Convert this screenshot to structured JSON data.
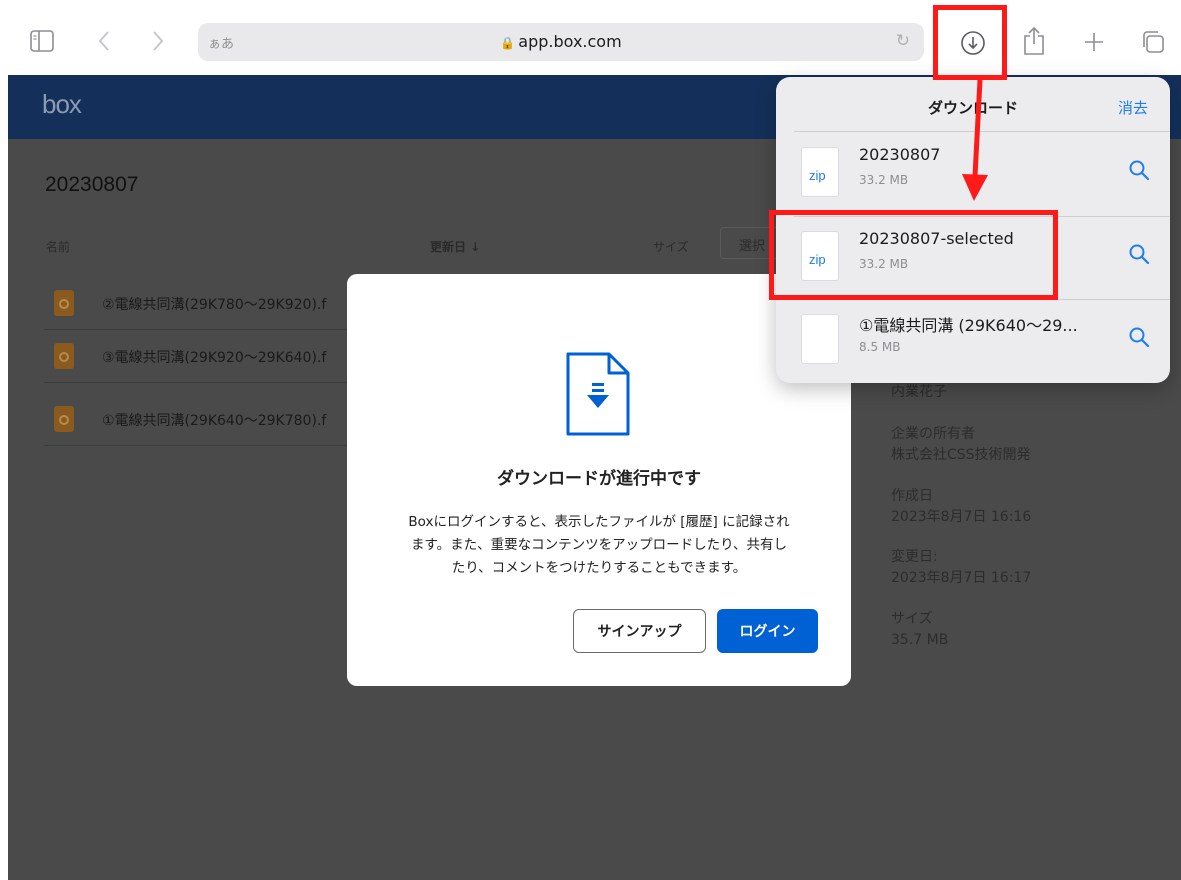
{
  "browser": {
    "address_aa": "ぁあ",
    "url": "app.box.com"
  },
  "icons": {
    "sidebar": "sidebar-icon",
    "back": "back-chevron-icon",
    "forward": "forward-chevron-icon",
    "lock": "lock-icon",
    "reload": "reload-icon",
    "downloads": "download-circle-icon",
    "share": "share-icon",
    "new_tab": "plus-icon",
    "tabs": "tabs-icon"
  },
  "box": {
    "logo": "box",
    "folder_title": "20230807",
    "columns": {
      "name": "名前",
      "modified": "更新日 ↓",
      "size": "サイズ",
      "select": "選択"
    },
    "files": [
      {
        "name": "②電線共同溝(29K780～29K920).f"
      },
      {
        "name": "③電線共同溝(29K920～29K640).f"
      },
      {
        "name": "①電線共同溝(29K640～29K780).f"
      }
    ],
    "details": {
      "owner_name": "内業花子",
      "enterprise_owner_label": "企業の所有者",
      "enterprise_owner": "株式会社CSS技術開発",
      "created_label": "作成日",
      "created": "2023年8月7日 16:16",
      "modified_label": "変更日:",
      "modified": "2023年8月7日 16:17",
      "size_label": "サイズ",
      "size": "35.7 MB"
    }
  },
  "dialog": {
    "title": "ダウンロードが進行中です",
    "body_line1": "Boxにログインすると、表示したファイルが [履歴] に記録され",
    "body_line2": "ます。また、重要なコンテンツをアップロードしたり、共有し",
    "body_line3": "たり、コメントをつけたりすることもできます。",
    "signup": "サインアップ",
    "login": "ログイン"
  },
  "downloads": {
    "title": "ダウンロード",
    "clear": "消去",
    "items": [
      {
        "name": "20230807",
        "size": "33.2 MB",
        "ext": "zip"
      },
      {
        "name": "20230807-selected",
        "size": "33.2 MB",
        "ext": "zip"
      },
      {
        "name": "①電線共同溝 (29K640～29...",
        "size": "8.5 MB",
        "ext": ""
      }
    ]
  },
  "colors": {
    "accent_blue": "#1e7cf2",
    "box_blue": "#0061d5",
    "annotation_red": "#ff1a1a"
  }
}
